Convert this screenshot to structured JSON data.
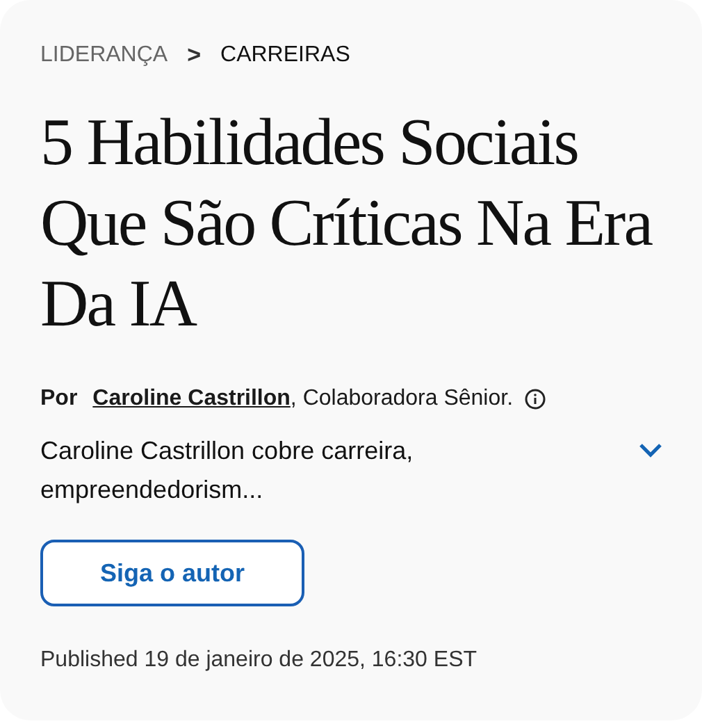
{
  "breadcrumb": [
    {
      "label": "LIDERANÇA",
      "current": false
    },
    {
      "label": "CARREIRAS",
      "current": true
    }
  ],
  "breadcrumb_separator": ">",
  "title": "5 Habilidades Sociais Que São Críticas Na Era Da IA",
  "byline": {
    "prefix": "Por",
    "author": "Caroline Castrillon",
    "role": ", Colaboradora Sênior."
  },
  "bio": {
    "text": "Caroline Castrillon cobre carreira, empreendedorism...",
    "expanded": false
  },
  "follow_button": "Siga o autor",
  "published": "Published 19 de janeiro de 2025, 16:30 EST"
}
